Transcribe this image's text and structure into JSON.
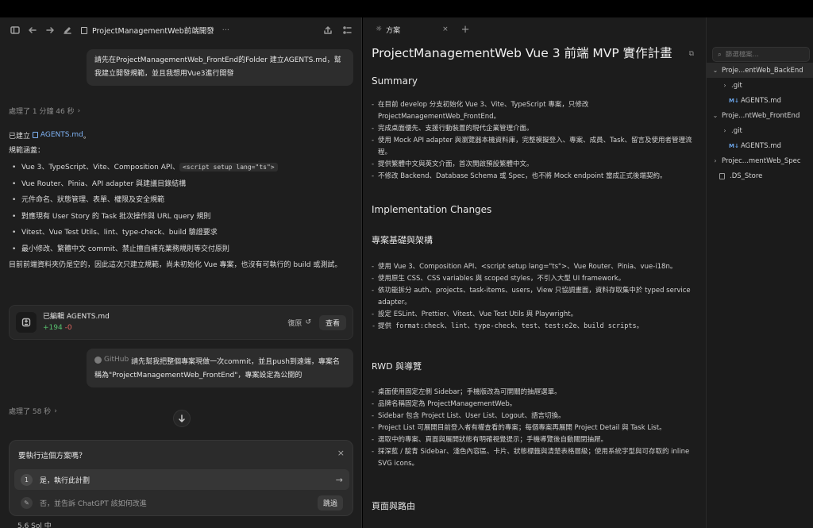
{
  "left_header": {
    "title": "ProjectManagementWeb前端開發",
    "more": "···"
  },
  "messages": {
    "user1": "請先在ProjectManagementWeb_FrontEnd的Folder 建立AGENTS.md，幫我建立開發規範，並且我想用Vue3進行開發",
    "thought1": "處理了 1 分鐘 46 秒",
    "answer_prefix": "已建立",
    "answer_file": "AGENTS.md",
    "answer_suffix": "。",
    "scope_title": "規範涵蓋：",
    "bullets": [
      "Vue 3、TypeScript、Vite、Composition API、",
      "Vue Router、Pinia、API adapter 與建議目錄結構",
      "元件命名、狀態管理、表單、權限及安全規範",
      "對應現有 User Story 的 Task 批次操作與 URL query 規則",
      "Vitest、Vue Test Utils、lint、type-check、build 驗證要求",
      "最小修改、繁體中文 commit、禁止擅自補充業務規則等交付原則"
    ],
    "bullet_code": "<script setup lang=\"ts\">",
    "closing": "目前前端資料夾仍是空的，因此這次只建立規範，尚未初始化 Vue 專案，也沒有可執行的 build 或測試。",
    "edit_card": {
      "label": "已編輯 AGENTS.md",
      "added": "+194",
      "removed": "-0",
      "undo": "復原",
      "view": "查看"
    },
    "user2_source": "GitHub",
    "user2": "請先幫我把整個專案現做一次commit，並且push到遠端，專案名稱為\"ProjectManagementWeb_FrontEnd\"，專案設定為公開的",
    "thought2": "處理了 58 秒"
  },
  "confirm": {
    "question": "要執行這個方案嗎？",
    "option1_num": "1",
    "option1": "是，執行此計劃",
    "option2": "否，並告訴 ChatGPT 該如何改進",
    "skip": "跳過"
  },
  "model_label": "5.6 Sol 中",
  "plan": {
    "tab_label": "方案",
    "title": "ProjectManagementWeb Vue 3 前端 MVP 實作計畫",
    "summary_heading": "Summary",
    "summary": [
      "在目前 develop 分支初始化 Vue 3、Vite、TypeScript 專案，只修改 ProjectManagementWeb_FrontEnd。",
      "完成桌面優先、支援行動裝置的現代企業管理介面。",
      "使用 Mock API adapter 與瀏覽器本機資料庫，完整模擬登入、專案、成員、Task、留言及使用者管理流程。",
      "提供繁體中文與英文介面，首次開啟預設繁體中文。",
      "不修改 Backend、Database Schema 或 Spec，也不將 Mock endpoint 當成正式後端契約。"
    ],
    "impl_heading": "Implementation Changes",
    "arch_heading": "專案基礎與架構",
    "arch": [
      "使用 Vue 3、Composition API、<script setup lang=\"ts\">、Vue Router、Pinia、vue-i18n。",
      "使用原生 CSS、CSS variables 與 scoped styles，不引入大型 UI framework。",
      "依功能拆分 auth、projects、task-items、users，View 只協調畫面，資料存取集中於 typed service adapter。",
      "設定 ESLint、Prettier、Vitest、Vue Test Utils 與 Playwright。",
      "提供 format:check、lint、type-check、test、test:e2e、build scripts。"
    ],
    "rwd_heading": "RWD 與導覽",
    "rwd": [
      "桌面使用固定左側 Sidebar；手機版改為可開關的抽屜選單。",
      "品牌名稱固定為 ProjectManagementWeb。",
      "Sidebar 包含 Project List、User List、Logout、語言切換。",
      "Project List 可展開目前登入者有權查看的專案；每個專案再展開 Project Detail 與 Task List。",
      "選取中的專案、頁面與展開狀態有明確視覺提示；手機導覽後自動關閉抽屜。",
      "採深藍 / 靛青 Sidebar、淺色內容區、卡片、狀態標籤與清楚表格層級；使用系統字型與可存取的 inline SVG icons。"
    ],
    "routes_heading": "頁面與路由"
  },
  "files": {
    "search_placeholder": "篩選檔案...",
    "tree": [
      {
        "label": "Proje...entWeb_BackEnd",
        "caret": "⌄",
        "indent": 0,
        "type": "folder"
      },
      {
        "label": ".git",
        "caret": "›",
        "indent": 1,
        "type": "folder"
      },
      {
        "label": "AGENTS.md",
        "caret": "",
        "indent": 1,
        "type": "md"
      },
      {
        "label": "Proje...ntWeb_FrontEnd",
        "caret": "⌄",
        "indent": 0,
        "type": "folder"
      },
      {
        "label": ".git",
        "caret": "›",
        "indent": 1,
        "type": "folder"
      },
      {
        "label": "AGENTS.md",
        "caret": "",
        "indent": 1,
        "type": "md"
      },
      {
        "label": "Projec...mentWeb_Spec",
        "caret": "›",
        "indent": 0,
        "type": "folder"
      },
      {
        "label": ".DS_Store",
        "caret": "",
        "indent": 0,
        "type": "file"
      }
    ]
  },
  "colors": {
    "accent_link": "#7fb3f5",
    "added": "#58c06f",
    "removed": "#e0665f"
  }
}
